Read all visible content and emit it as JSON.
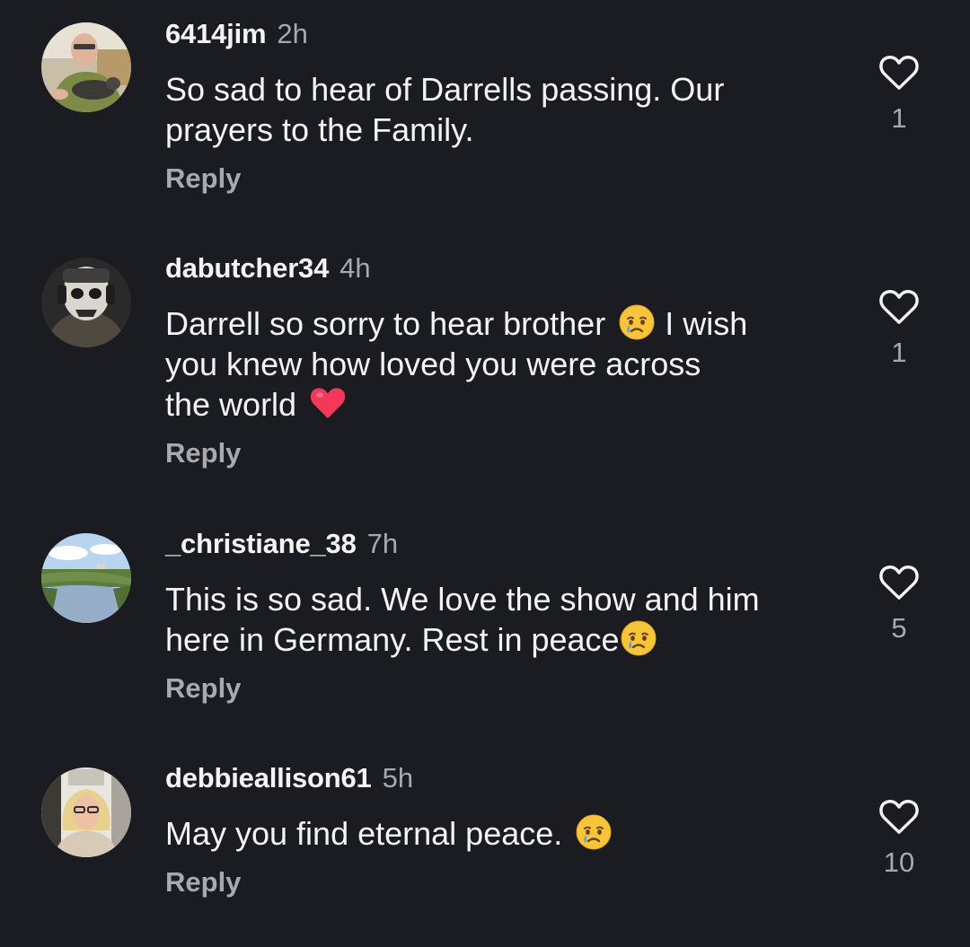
{
  "comments": [
    {
      "username": "6414jim",
      "time": "2h",
      "lines": [
        "So sad to hear of Darrells passing. Our",
        "prayers to the Family."
      ],
      "reply_label": "Reply",
      "likes": "1",
      "avatar": "man-with-dog-avatar"
    },
    {
      "username": "dabutcher34",
      "time": "4h",
      "lines": [
        "Darrell so sorry to hear brother",
        "I wish",
        "you knew how loved you were across",
        "the world"
      ],
      "reply_label": "Reply",
      "likes": "1",
      "avatar": "masked-soldier-avatar",
      "emojis": [
        "crying-face-emoji",
        "red-heart-emoji"
      ]
    },
    {
      "username": "_christiane_38",
      "time": "7h",
      "lines": [
        "This is so sad. We love the show and him",
        "here in Germany. Rest in peace"
      ],
      "reply_label": "Reply",
      "likes": "5",
      "avatar": "river-landscape-avatar",
      "emojis": [
        "crying-face-emoji"
      ]
    },
    {
      "username": "debbieallison61",
      "time": "5h",
      "lines": [
        "May you find eternal peace."
      ],
      "reply_label": "Reply",
      "likes": "10",
      "avatar": "woman-with-glasses-avatar",
      "emojis": [
        "crying-face-emoji"
      ]
    }
  ],
  "colors": {
    "background": "#1b1c21",
    "primary_text": "#f3f4f6",
    "secondary_text": "#a8a9ae",
    "heart_outline": "#f3f4f6",
    "emoji_heart": "#f4385a"
  },
  "icons": {
    "like": "heart-outline-icon"
  }
}
